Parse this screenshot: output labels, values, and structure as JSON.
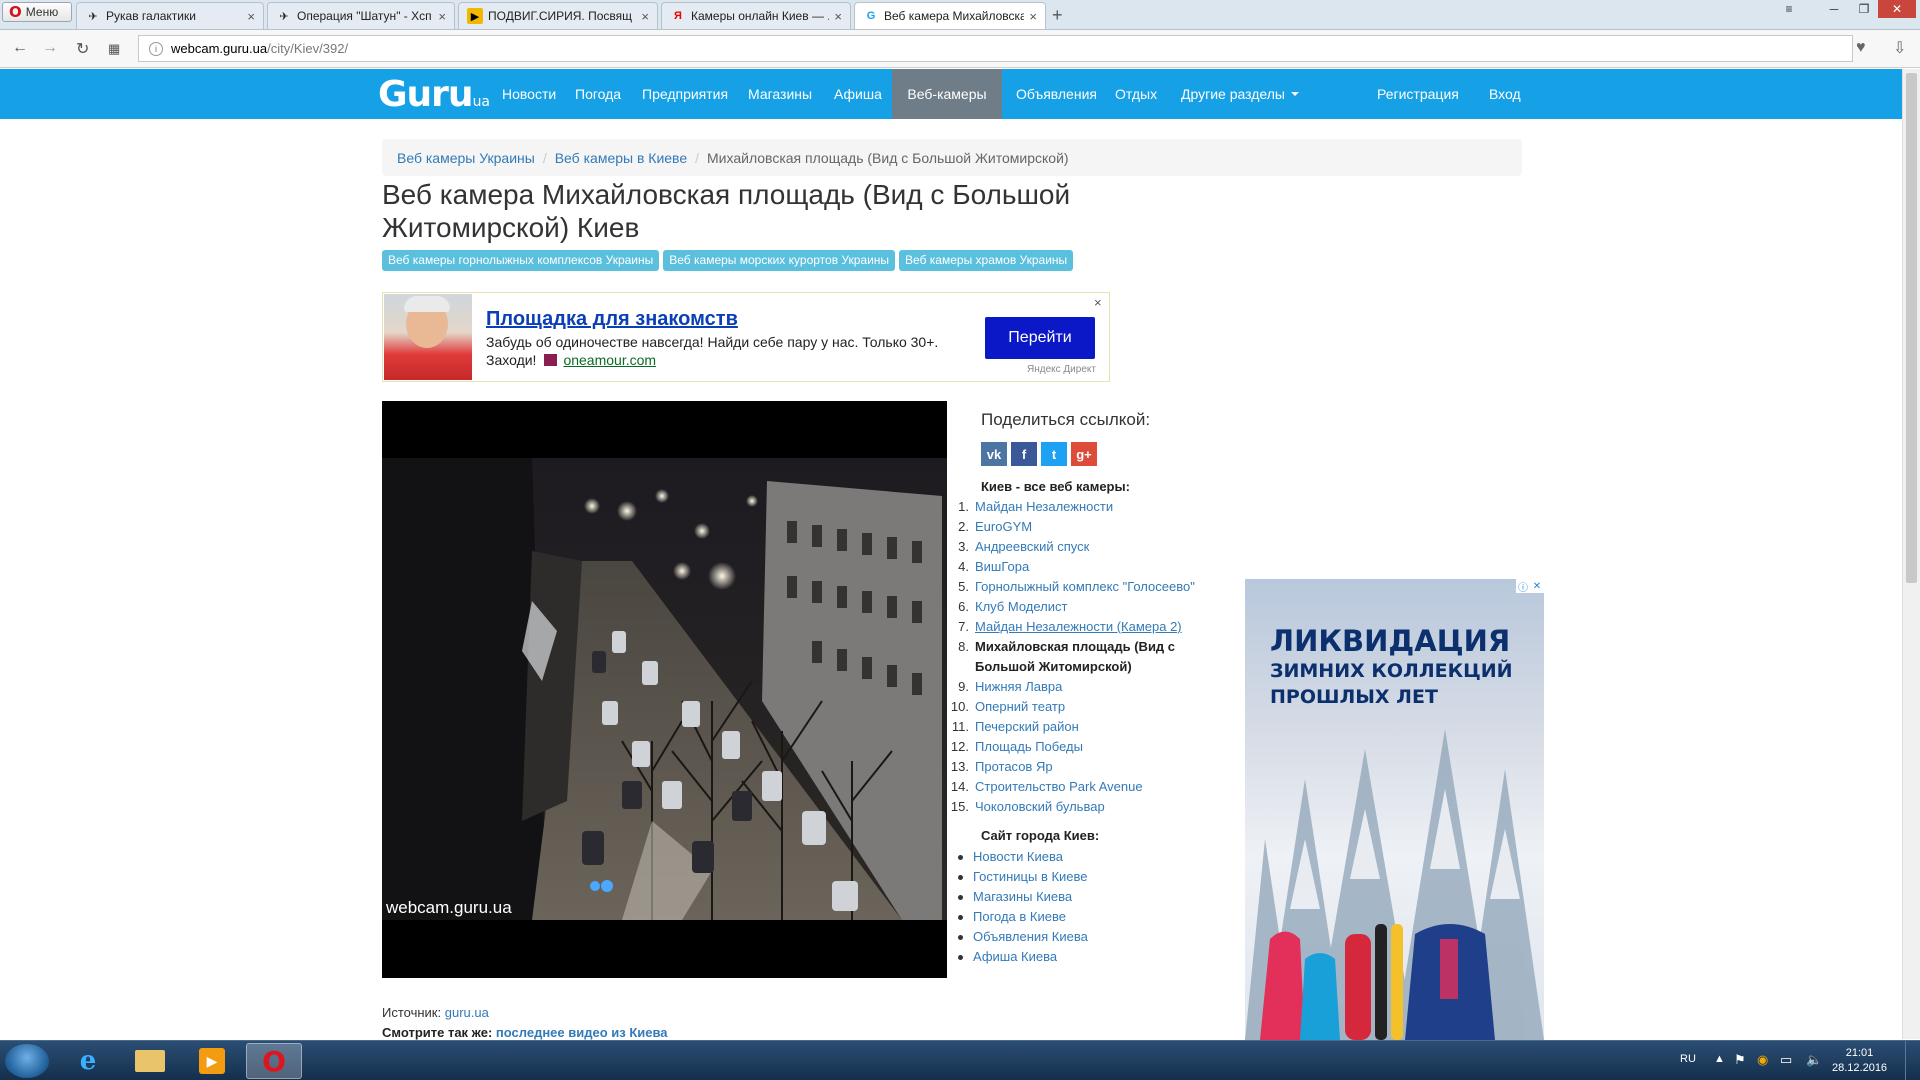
{
  "browser": {
    "menu_label": "Меню",
    "tabs": [
      {
        "title": "Рукав галактики",
        "icon": "aircraft-icon"
      },
      {
        "title": "Операция \"Шатун\" - Хсп",
        "icon": "aircraft-icon"
      },
      {
        "title": "ПОДВИГ.СИРИЯ. Посвящ",
        "icon": "video-icon"
      },
      {
        "title": "Камеры онлайн Киев — ...",
        "icon": "yandex-icon"
      },
      {
        "title": "Веб камера Михайловска",
        "icon": "guru-icon"
      }
    ],
    "url_domain": "webcam.guru.ua",
    "url_path": "/city/Kiev/392/"
  },
  "site": {
    "logo": "Guru",
    "logo_suffix": "ua",
    "nav": [
      "Новости",
      "Погода",
      "Предприятия",
      "Магазины",
      "Афиша",
      "Веб-камеры",
      "Объявления",
      "Отдых",
      "Другие разделы"
    ],
    "register": "Регистрация",
    "login": "Вход"
  },
  "breadcrumb": {
    "items": [
      "Веб камеры Украины",
      "Веб камеры в Киеве"
    ],
    "current": "Михайловская площадь (Вид с Большой Житомирской)"
  },
  "title": "Веб камера Михайловская площадь (Вид с Большой Житомирской) Киев",
  "tags": [
    "Веб камеры горнолыжных комплексов Украины",
    "Веб камеры морских курортов Украины",
    "Веб камеры храмов Украины"
  ],
  "ad": {
    "headline": "Площадка для знакомств",
    "text": "Забудь об одиночестве навсегда! Найди себе пару у нас. Только 30+. Заходи!",
    "domain": "oneamour.com",
    "button": "Перейти",
    "provider": "Яндекс Директ",
    "close": "×"
  },
  "camera": {
    "watermark": "webcam.guru.ua"
  },
  "share": {
    "title": "Поделиться ссылкой:",
    "buttons": [
      {
        "label": "vk",
        "color": "#4c75a3"
      },
      {
        "label": "f",
        "color": "#3b5998"
      },
      {
        "label": "t",
        "color": "#1da1f2"
      },
      {
        "label": "g+",
        "color": "#dd4b39"
      }
    ]
  },
  "kiev_cams": {
    "title": "Киев - все веб камеры:",
    "items": [
      {
        "n": "1.",
        "label": "Майдан Незалежности"
      },
      {
        "n": "2.",
        "label": "EuroGYM"
      },
      {
        "n": "3.",
        "label": "Андреевский спуск"
      },
      {
        "n": "4.",
        "label": "ВишГора"
      },
      {
        "n": "5.",
        "label": "Горнолыжный комплекс \"Голосеево\""
      },
      {
        "n": "6.",
        "label": "Клуб Моделист"
      },
      {
        "n": "7.",
        "label": "Майдан Незалежности (Камера 2)"
      },
      {
        "n": "8.",
        "label": "Михайловская площадь (Вид с Большой Житомирской)"
      },
      {
        "n": "9.",
        "label": "Нижняя Лавра"
      },
      {
        "n": "10.",
        "label": "Оперний театр"
      },
      {
        "n": "11.",
        "label": "Печерский район"
      },
      {
        "n": "12.",
        "label": "Площадь Победы"
      },
      {
        "n": "13.",
        "label": "Протасов Яр"
      },
      {
        "n": "14.",
        "label": "Строительство Park Avenue"
      },
      {
        "n": "15.",
        "label": "Чоколовский бульвар"
      }
    ]
  },
  "city_site": {
    "title": "Сайт города Киев:",
    "items": [
      "Новости Киева",
      "Гостиницы в Киеве",
      "Магазины Киева",
      "Погода в Киеве",
      "Объявления Киева",
      "Афиша Киева"
    ]
  },
  "source": {
    "label": "Источник:",
    "link": "guru.ua"
  },
  "see_also": {
    "label": "Смотрите так же:",
    "link": "последнее видео из Киева"
  },
  "side_ad": {
    "line1": "ЛИКВИДАЦИЯ",
    "line2": "ЗИМНИХ КОЛЛЕКЦИЙ",
    "line3": "ПРОШЛЫХ ЛЕТ"
  },
  "taskbar": {
    "lang": "RU",
    "time": "21:01",
    "date": "28.12.2016"
  }
}
